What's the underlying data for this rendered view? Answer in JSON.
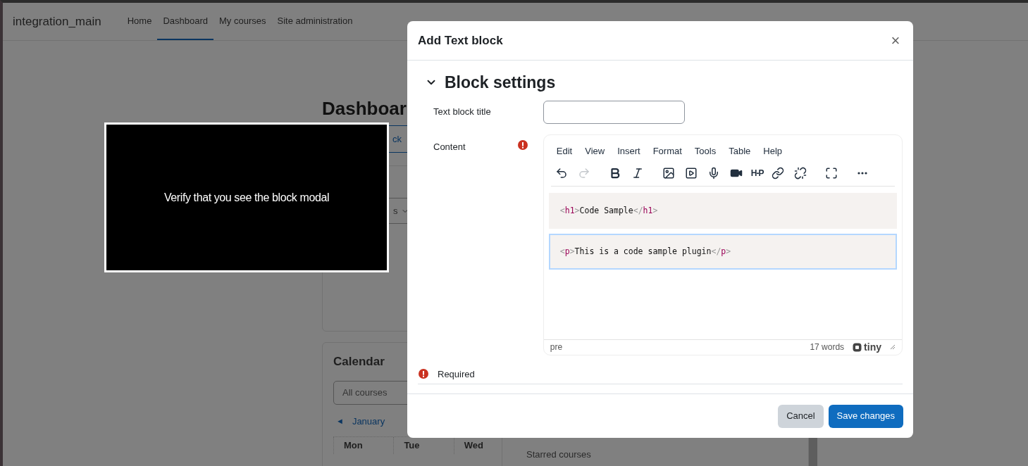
{
  "navbar": {
    "brand": "integration_main",
    "items": [
      {
        "label": "Home",
        "selected": false
      },
      {
        "label": "Dashboard",
        "selected": true
      },
      {
        "label": "My courses",
        "selected": false
      },
      {
        "label": "Site administration",
        "selected": false
      }
    ]
  },
  "page": {
    "heading": "Dashboar",
    "add_block_fragment": "ck",
    "select_fragment": "s",
    "calendar": {
      "title": "Calendar",
      "course_select": "All courses",
      "month_nav": {
        "arrow": "◄",
        "label": "January"
      },
      "columns": [
        "Mon",
        "Tue",
        "Wed"
      ]
    },
    "drawer": {
      "items": [
        "Starred courses"
      ]
    }
  },
  "overlay_message": "Verify that you see the block modal",
  "modal": {
    "title": "Add Text block",
    "close": "×",
    "section": {
      "title": "Block settings",
      "expanded": true
    },
    "title_field": {
      "label": "Text block title"
    },
    "content_field": {
      "label": "Content",
      "required": true,
      "editor": {
        "menu": [
          "Edit",
          "View",
          "Insert",
          "Format",
          "Tools",
          "Table",
          "Help"
        ],
        "toolbar": [
          [
            {
              "disabled": false
            },
            {
              "disabled": true
            }
          ],
          [
            {
              "disabled": false
            },
            {
              "disabled": false
            }
          ],
          [
            {
              "disabled": false
            },
            {
              "disabled": false
            },
            {
              "disabled": false
            },
            {
              "disabled": false
            },
            {
              "text": "H-P",
              "disabled": false
            },
            {
              "disabled": false
            },
            {
              "disabled": false
            }
          ],
          [
            {
              "disabled": false
            }
          ],
          [
            {
              "disabled": false
            }
          ]
        ],
        "blocks": [
          {
            "selected": false,
            "parts": [
              {
                "kind": "punct",
                "text": "<"
              },
              {
                "kind": "tag",
                "text": "h1"
              },
              {
                "kind": "punct",
                "text": ">"
              },
              {
                "kind": "text",
                "text": "Code Sample"
              },
              {
                "kind": "punct",
                "text": "</"
              },
              {
                "kind": "tag",
                "text": "h1"
              },
              {
                "kind": "punct",
                "text": ">"
              }
            ]
          },
          {
            "selected": true,
            "parts": [
              {
                "kind": "punct",
                "text": "<"
              },
              {
                "kind": "tag",
                "text": "p"
              },
              {
                "kind": "punct",
                "text": ">"
              },
              {
                "kind": "text",
                "text": "This is a code sample plugin"
              },
              {
                "kind": "punct",
                "text": "</"
              },
              {
                "kind": "tag",
                "text": "p"
              },
              {
                "kind": "punct",
                "text": ">"
              }
            ]
          }
        ],
        "path": "pre",
        "word_count": "17 words",
        "brand": "tiny"
      }
    },
    "required_note": "Required",
    "buttons": [
      {
        "label": "Cancel",
        "kind": "secondary"
      },
      {
        "label": "Save changes",
        "kind": "primary"
      }
    ]
  }
}
